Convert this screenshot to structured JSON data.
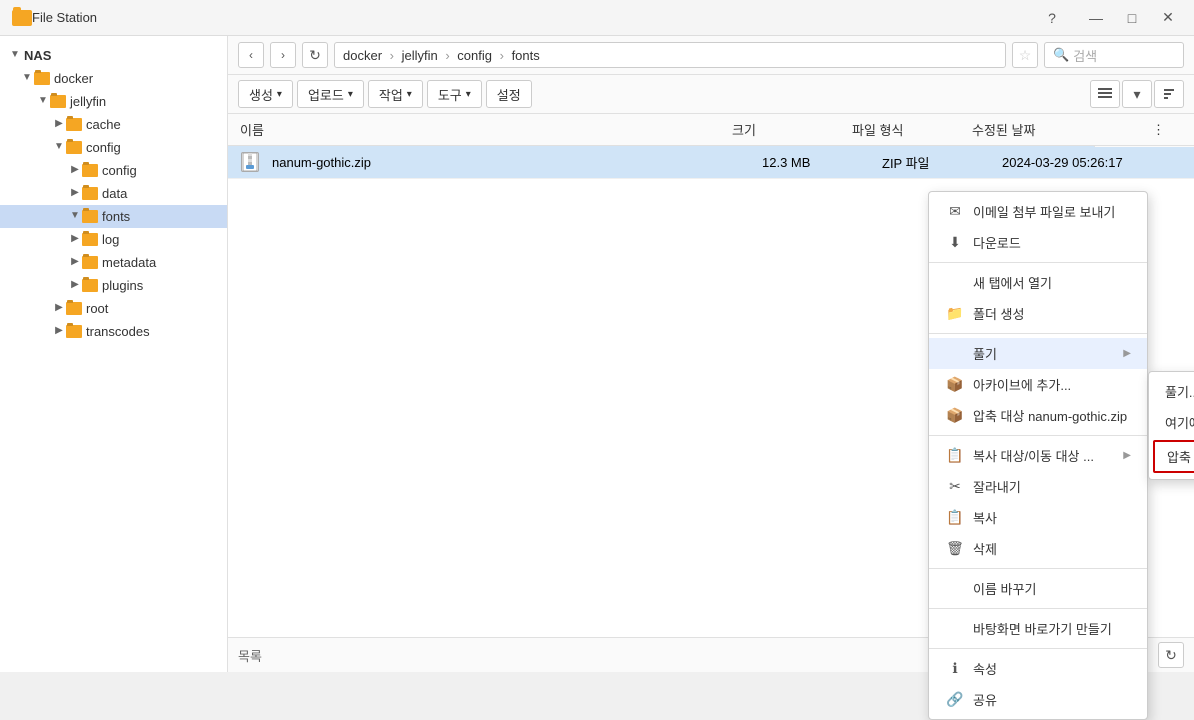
{
  "titlebar": {
    "title": "File Station",
    "help_label": "?",
    "minimize_label": "—",
    "maximize_label": "□",
    "close_label": "✕"
  },
  "sidebar": {
    "nas_label": "NAS",
    "docker_label": "docker",
    "jellyfin_label": "jellyfin",
    "cache_label": "cache",
    "config_label": "config",
    "config_sub_label": "config",
    "data_label": "data",
    "fonts_label": "fonts",
    "log_label": "log",
    "metadata_label": "metadata",
    "plugins_label": "plugins",
    "root_label": "root",
    "transcodes_label": "transcodes"
  },
  "toolbar": {
    "back_label": "‹",
    "forward_label": "›",
    "refresh_label": "↻",
    "path": "docker › jellyfin › config › fonts",
    "star_label": "☆",
    "search_placeholder": "검색",
    "search_icon": "🔍"
  },
  "action_toolbar": {
    "create_label": "생성",
    "upload_label": "업로드",
    "action_label": "작업",
    "tools_label": "도구",
    "settings_label": "설정",
    "view_icon": "☰",
    "sort_icon": "↕"
  },
  "file_list": {
    "columns": {
      "name": "이름",
      "size": "크기",
      "type": "파일 형식",
      "date": "수정된 날짜",
      "more": "⋮"
    },
    "files": [
      {
        "name": "nanum-gothic.zip",
        "size": "12.3 MB",
        "type": "ZIP 파일",
        "date": "2024-03-29 05:26:17"
      }
    ]
  },
  "context_menu": {
    "email_label": "이메일 첨부 파일로 보내기",
    "download_label": "다운로드",
    "new_tab_label": "새 탭에서 열기",
    "new_folder_label": "폴더 생성",
    "extract_label": "풀기",
    "archive_add_label": "아카이브에 추가...",
    "compress_label": "압축 대상 nanum-gothic.zip",
    "copy_move_label": "복사 대상/이동 대상 ...",
    "cut_label": "잘라내기",
    "copy_label": "복사",
    "delete_label": "삭제",
    "rename_label": "이름 바꾸기",
    "desktop_label": "바탕화면 바로가기 만들기",
    "properties_label": "속성",
    "share_label": "공유"
  },
  "submenu": {
    "extract_label": "풀기...",
    "extract_here_label": "여기에 압축 풀기",
    "extract_to_label": "압축 풀기 위치 nanum-gothic/"
  },
  "right_panel": {
    "date_label": "2024-"
  },
  "bottom_bar": {
    "list_label": "목록",
    "refresh_label": "↻"
  }
}
